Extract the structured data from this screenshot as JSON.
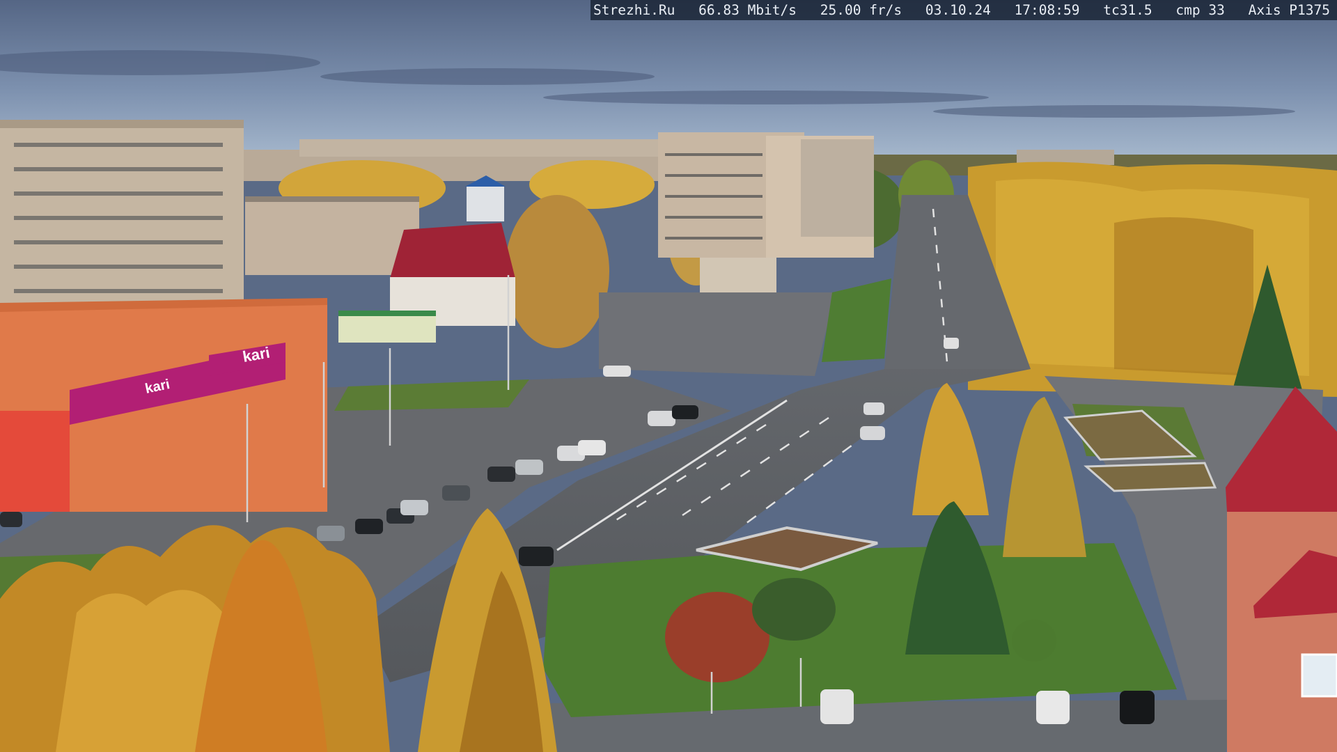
{
  "overlay": {
    "site": "Strezhi.Ru",
    "bitrate": "66.83 Mbit/s",
    "framerate": "25.00 fr/s",
    "date": "03.10.24",
    "time": "17:08:59",
    "tc": "tc31.5",
    "cmp": "cmp 33",
    "camera": "Axis P1375"
  },
  "signs": {
    "store_brand": "kari",
    "store_banner_brand": "kari"
  },
  "colors": {
    "sky_top": "#5b6d8f",
    "sky_horizon": "#9db1c9",
    "foliage_gold": "#c9a033",
    "foliage_orange": "#c27d22",
    "asphalt": "#5a5d62",
    "grass": "#4d7a34",
    "store_orange": "#e07a4a",
    "store_magenta": "#b21f74",
    "roof_red": "#b02838"
  }
}
